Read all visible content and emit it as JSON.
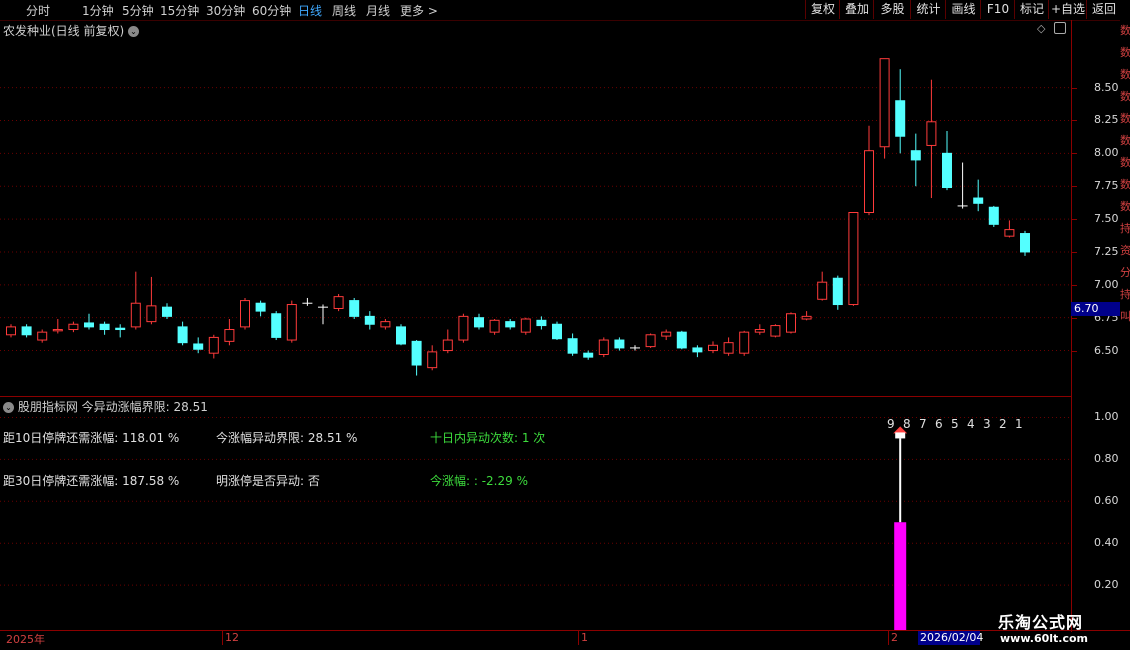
{
  "toolbar": {
    "periods": [
      "分时",
      "1分钟",
      "5分钟",
      "15分钟",
      "30分钟",
      "60分钟",
      "日线",
      "周线",
      "月线",
      "更多 >"
    ],
    "active_period": "日线",
    "right_buttons": [
      "复权",
      "叠加",
      "多股",
      "统计",
      "画线",
      "F10",
      "标记",
      "+自选",
      "返回"
    ]
  },
  "main": {
    "title": "农发种业(日线 前复权)",
    "price_tag": "6.70",
    "y_labels": [
      "8.50",
      "8.25",
      "8.00",
      "7.75",
      "7.50",
      "7.25",
      "7.00",
      "6.75",
      "6.50"
    ],
    "side_strip_text": "数 数 数 数 数 数 数 数 数 持 资 分 持 叫"
  },
  "indicator": {
    "title": "股朋指标网 今异动涨幅界限: 28.51",
    "row1_col1": "距10日停牌还需涨幅: 118.01 %",
    "row1_col2": "今涨幅异动界限: 28.51 %",
    "row1_col3": "十日内异动次数: 1 次",
    "row2_col1": "距30日停牌还需涨幅: 187.58 %",
    "row2_col2": "明涨停是否异动: 否",
    "row2_col3": "今涨幅: : -2.29 %",
    "countdown": [
      "9",
      "8",
      "7",
      "6",
      "5",
      "4",
      "3",
      "2",
      "1"
    ],
    "y_labels": [
      "1.00",
      "0.80",
      "0.60",
      "0.40",
      "0.20"
    ]
  },
  "bottom": {
    "labels": [
      "2025年",
      "12",
      "1",
      "2"
    ],
    "date_box": "2026/02/04",
    "watermark_title": "乐淘公式网",
    "watermark_url": "www.60lt.com"
  },
  "colors": {
    "up": "#ff3b3b",
    "down": "#54ffff",
    "grid": "#8b0000",
    "magenta": "#ff00ff"
  },
  "chart_data": {
    "type": "candlestick",
    "title": "农发种业(日线 前复权)",
    "ylim": [
      6.2,
      8.9
    ],
    "candles": [
      {
        "o": 6.62,
        "c": 6.68,
        "h": 6.7,
        "l": 6.6
      },
      {
        "o": 6.68,
        "c": 6.62,
        "h": 6.7,
        "l": 6.6
      },
      {
        "o": 6.58,
        "c": 6.64,
        "h": 6.66,
        "l": 6.56
      },
      {
        "o": 6.65,
        "c": 6.66,
        "h": 6.74,
        "l": 6.63
      },
      {
        "o": 6.66,
        "c": 6.7,
        "h": 6.72,
        "l": 6.64
      },
      {
        "o": 6.71,
        "c": 6.68,
        "h": 6.78,
        "l": 6.66
      },
      {
        "o": 6.7,
        "c": 6.66,
        "h": 6.72,
        "l": 6.62
      },
      {
        "o": 6.67,
        "c": 6.66,
        "h": 6.7,
        "l": 6.6
      },
      {
        "o": 6.68,
        "c": 6.86,
        "h": 7.1,
        "l": 6.66
      },
      {
        "o": 6.72,
        "c": 6.84,
        "h": 7.06,
        "l": 6.7
      },
      {
        "o": 6.83,
        "c": 6.76,
        "h": 6.86,
        "l": 6.74
      },
      {
        "o": 6.68,
        "c": 6.56,
        "h": 6.72,
        "l": 6.54
      },
      {
        "o": 6.55,
        "c": 6.51,
        "h": 6.6,
        "l": 6.48
      },
      {
        "o": 6.48,
        "c": 6.6,
        "h": 6.62,
        "l": 6.44
      },
      {
        "o": 6.57,
        "c": 6.66,
        "h": 6.74,
        "l": 6.54
      },
      {
        "o": 6.68,
        "c": 6.88,
        "h": 6.9,
        "l": 6.66
      },
      {
        "o": 6.86,
        "c": 6.8,
        "h": 6.88,
        "l": 6.76
      },
      {
        "o": 6.78,
        "c": 6.6,
        "h": 6.8,
        "l": 6.58
      },
      {
        "o": 6.58,
        "c": 6.85,
        "h": 6.88,
        "l": 6.56
      },
      {
        "o": 6.86,
        "c": 6.86,
        "h": 6.9,
        "l": 6.84
      },
      {
        "o": 6.83,
        "c": 6.83,
        "h": 6.85,
        "l": 6.7
      },
      {
        "o": 6.82,
        "c": 6.91,
        "h": 6.93,
        "l": 6.8
      },
      {
        "o": 6.88,
        "c": 6.76,
        "h": 6.9,
        "l": 6.74
      },
      {
        "o": 6.76,
        "c": 6.7,
        "h": 6.8,
        "l": 6.66
      },
      {
        "o": 6.68,
        "c": 6.72,
        "h": 6.74,
        "l": 6.66
      },
      {
        "o": 6.68,
        "c": 6.55,
        "h": 6.7,
        "l": 6.54
      },
      {
        "o": 6.57,
        "c": 6.39,
        "h": 6.58,
        "l": 6.31
      },
      {
        "o": 6.37,
        "c": 6.49,
        "h": 6.54,
        "l": 6.35
      },
      {
        "o": 6.5,
        "c": 6.58,
        "h": 6.66,
        "l": 6.48
      },
      {
        "o": 6.58,
        "c": 6.76,
        "h": 6.78,
        "l": 6.56
      },
      {
        "o": 6.75,
        "c": 6.68,
        "h": 6.78,
        "l": 6.66
      },
      {
        "o": 6.64,
        "c": 6.73,
        "h": 6.74,
        "l": 6.62
      },
      {
        "o": 6.72,
        "c": 6.68,
        "h": 6.74,
        "l": 6.66
      },
      {
        "o": 6.64,
        "c": 6.74,
        "h": 6.75,
        "l": 6.62
      },
      {
        "o": 6.73,
        "c": 6.69,
        "h": 6.76,
        "l": 6.66
      },
      {
        "o": 6.7,
        "c": 6.59,
        "h": 6.72,
        "l": 6.58
      },
      {
        "o": 6.59,
        "c": 6.48,
        "h": 6.63,
        "l": 6.46
      },
      {
        "o": 6.48,
        "c": 6.45,
        "h": 6.5,
        "l": 6.43
      },
      {
        "o": 6.47,
        "c": 6.58,
        "h": 6.6,
        "l": 6.45
      },
      {
        "o": 6.58,
        "c": 6.52,
        "h": 6.6,
        "l": 6.5
      },
      {
        "o": 6.52,
        "c": 6.52,
        "h": 6.54,
        "l": 6.5
      },
      {
        "o": 6.53,
        "c": 6.62,
        "h": 6.63,
        "l": 6.52
      },
      {
        "o": 6.61,
        "c": 6.64,
        "h": 6.66,
        "l": 6.58
      },
      {
        "o": 6.64,
        "c": 6.52,
        "h": 6.65,
        "l": 6.51
      },
      {
        "o": 6.52,
        "c": 6.49,
        "h": 6.54,
        "l": 6.45
      },
      {
        "o": 6.5,
        "c": 6.54,
        "h": 6.57,
        "l": 6.48
      },
      {
        "o": 6.48,
        "c": 6.56,
        "h": 6.6,
        "l": 6.46
      },
      {
        "o": 6.48,
        "c": 6.64,
        "h": 6.65,
        "l": 6.46
      },
      {
        "o": 6.64,
        "c": 6.66,
        "h": 6.7,
        "l": 6.62
      },
      {
        "o": 6.61,
        "c": 6.69,
        "h": 6.7,
        "l": 6.6
      },
      {
        "o": 6.64,
        "c": 6.78,
        "h": 6.79,
        "l": 6.63
      },
      {
        "o": 6.74,
        "c": 6.76,
        "h": 6.8,
        "l": 6.73
      },
      {
        "o": 6.89,
        "c": 7.02,
        "h": 7.1,
        "l": 6.88
      },
      {
        "o": 7.05,
        "c": 6.85,
        "h": 7.07,
        "l": 6.81
      },
      {
        "o": 6.85,
        "c": 7.55,
        "h": 7.55,
        "l": 6.84
      },
      {
        "o": 7.55,
        "c": 8.02,
        "h": 8.21,
        "l": 7.53
      },
      {
        "o": 8.05,
        "c": 8.72,
        "h": 8.72,
        "l": 7.96
      },
      {
        "o": 8.4,
        "c": 8.13,
        "h": 8.64,
        "l": 8.0
      },
      {
        "o": 8.02,
        "c": 7.95,
        "h": 8.15,
        "l": 7.75
      },
      {
        "o": 8.06,
        "c": 8.24,
        "h": 8.56,
        "l": 7.66
      },
      {
        "o": 8.0,
        "c": 7.74,
        "h": 8.17,
        "l": 7.72
      },
      {
        "o": 7.6,
        "c": 7.6,
        "h": 7.93,
        "l": 7.58
      },
      {
        "o": 7.66,
        "c": 7.62,
        "h": 7.8,
        "l": 7.56
      },
      {
        "o": 7.59,
        "c": 7.46,
        "h": 7.6,
        "l": 7.44
      },
      {
        "o": 7.37,
        "c": 7.42,
        "h": 7.49,
        "l": 7.36
      },
      {
        "o": 7.39,
        "c": 7.25,
        "h": 7.41,
        "l": 7.22
      }
    ],
    "indicator_bar": {
      "index": 57,
      "value": 0.5,
      "line_top": 0.9,
      "ylim": [
        0.0,
        1.05
      ]
    }
  }
}
